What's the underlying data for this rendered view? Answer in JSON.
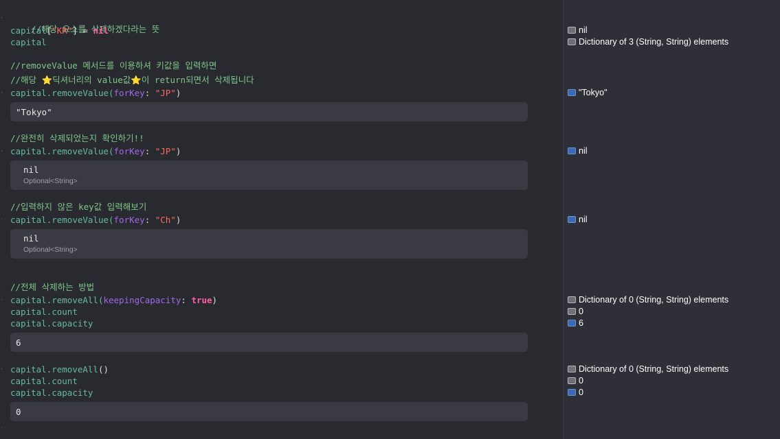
{
  "code": {
    "l1_comment": "//해당 요소를 삭제하겠다라는 뜻",
    "l2_var": "capital",
    "l2_open": "[",
    "l2_key": "\"KR\"",
    "l2_close": "] = ",
    "l2_nil": "nil",
    "l3_var": "capital",
    "l4_comment": "//removeValue 메서드를 이용하셔 키값을 입력하면",
    "l5_comment_a": "//해당 ",
    "l5_star1": "⭐",
    "l5_comment_b": "딕셔너리의 value값",
    "l5_star2": "⭐",
    "l5_comment_c": "이 return되면서 삭제됩니다",
    "l6_var": "capital",
    "l6_method": ".removeValue(",
    "l6_param": "forKey",
    "l6_colon": ": ",
    "l6_str": "\"JP\"",
    "l6_end": ")",
    "l7_comment": "//완전히 삭제되었는지 확인하기!!",
    "l8_var": "capital",
    "l8_method": ".removeValue(",
    "l8_param": "forKey",
    "l8_colon": ": ",
    "l8_str": "\"JP\"",
    "l8_end": ")",
    "l9_comment": "//입력하지 않은 key값 입력해보기",
    "l10_var": "capital",
    "l10_method": ".removeValue(",
    "l10_param": "forKey",
    "l10_colon": ": ",
    "l10_str": "\"Ch\"",
    "l10_end": ")",
    "l11_comment": "//전체 삭제하는 방법",
    "l12_var": "capital",
    "l12_method": ".removeAll(",
    "l12_param": "keepingCapacity",
    "l12_colon": ": ",
    "l12_bool": "true",
    "l12_end": ")",
    "l13_var": "capital",
    "l13_prop": ".count",
    "l14_var": "capital",
    "l14_prop": ".capacity",
    "l15_var": "capital",
    "l15_method": ".removeAll",
    "l15_end": "()",
    "l16_var": "capital",
    "l16_prop": ".count",
    "l17_var": "capital",
    "l17_prop": ".capacity"
  },
  "inline_results": {
    "r1": "\"Tokyo\"",
    "r2_value": "nil",
    "r2_type": "Optional<String>",
    "r3_value": "nil",
    "r3_type": "Optional<String>",
    "r4": "6",
    "r5": "0"
  },
  "sidebar": {
    "s1": "nil",
    "s2": "Dictionary of 3 (String, String) elements",
    "s3": "\"Tokyo\"",
    "s4": "nil",
    "s5": "nil",
    "s6": "Dictionary of 0 (String, String) elements",
    "s7": "0",
    "s8": "6",
    "s9": "Dictionary of 0 (String, String) elements",
    "s10": "0",
    "s11": "0"
  },
  "colors": {
    "editor_bg": "#292a30",
    "sidebar_bg": "#2f3037",
    "comment": "#7fc58a",
    "string": "#fc6a5d",
    "keyword": "#fc5fa3",
    "variable": "#67b7a4",
    "parameter": "#a167e6"
  }
}
